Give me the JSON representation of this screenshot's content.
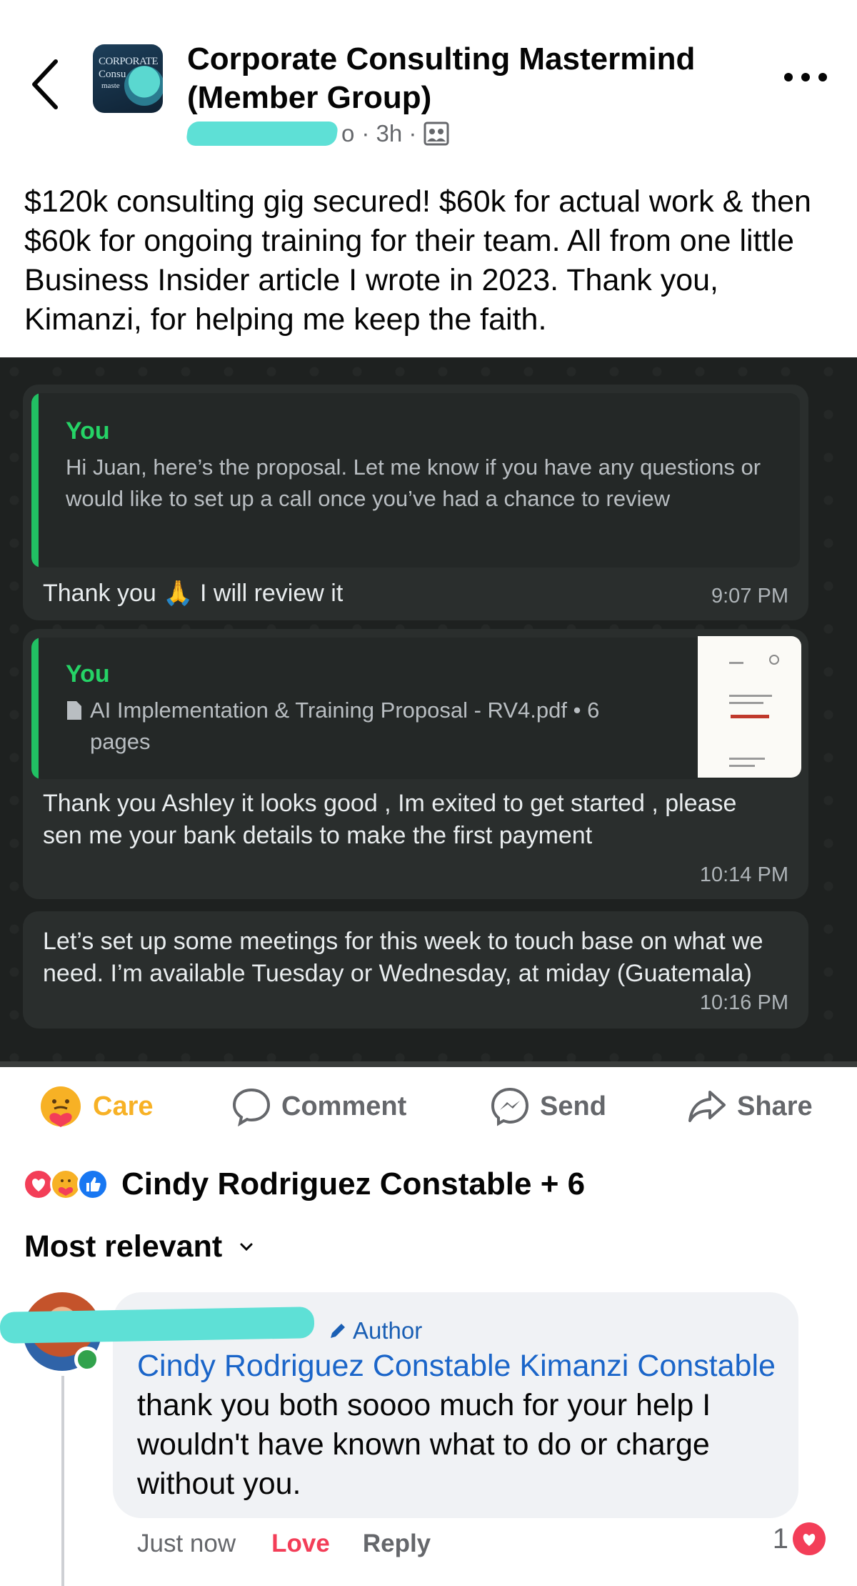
{
  "header": {
    "group_name": "Corporate Consulting Mastermind (Member Group)",
    "avatar_text_line1": "CORPORATE",
    "avatar_text_line2": "Consu",
    "avatar_text_line3": "maste",
    "author_suffix": "o",
    "time": "· 3h ·",
    "icons": {
      "back": "chevron-left-icon",
      "more": "more-horizontal-icon",
      "audience": "group-audience-icon"
    }
  },
  "post": {
    "text": "$120k consulting gig secured! $60k for actual work & then $60k for ongoing training for their team. All from one little Business Insider article I wrote in 2023. Thank you, Kimanzi, for helping me keep the faith."
  },
  "chat": {
    "messages": [
      {
        "quote_author": "You",
        "quote_text": "Hi Juan, here’s the proposal. Let me know if you have any questions or would like to set up a call once you’ve had a chance to review",
        "text_before": "Thank you",
        "emoji": "🙏",
        "text_after": "I will review it",
        "time": "9:07 PM"
      },
      {
        "quote_author": "You",
        "quote_text": "AI Implementation & Training Proposal - RV4.pdf • 6 pages",
        "text": "Thank you Ashley it looks good , Im exited to get started , please sen me your bank details to make the first payment",
        "time": "10:14 PM"
      },
      {
        "text": "Let’s set up some meetings for this week to touch base on what we need. I’m available Tuesday or Wednesday, at miday (Guatemala)",
        "time": "10:16 PM"
      }
    ]
  },
  "actions": {
    "care": "Care",
    "comment": "Comment",
    "send": "Send",
    "share": "Share"
  },
  "reactions": {
    "names": "Cindy Rodriguez Constable + 6",
    "types": [
      "love",
      "care",
      "like"
    ]
  },
  "comments_sort": "Most relevant",
  "comment": {
    "badge": "Author",
    "mention": "Cindy Rodriguez Constable Kimanzi Constable",
    "text": " thank you both soooo much for your help I wouldn't have known what to do or charge without you.",
    "time": "Just now",
    "love": "Love",
    "reply": "Reply",
    "reaction_count": "1"
  },
  "colors": {
    "care": "#f7b125",
    "love": "#f33e58",
    "like": "#1877f2",
    "whatsapp_green": "#25d366",
    "link": "#1a65c9"
  }
}
